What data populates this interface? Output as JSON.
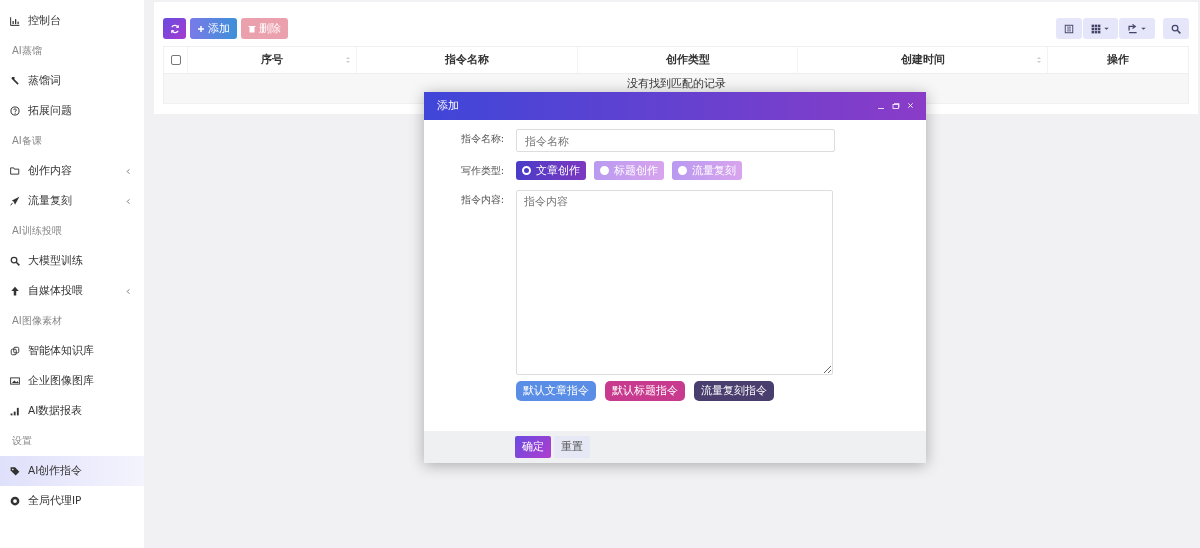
{
  "sidebar": {
    "items": [
      {
        "kind": "item",
        "label": "控制台",
        "selected": false,
        "submenu": false
      },
      {
        "kind": "header",
        "label": "AI蒸馏"
      },
      {
        "kind": "item",
        "label": "蒸馏词",
        "selected": false,
        "submenu": false
      },
      {
        "kind": "item",
        "label": "拓展问题",
        "selected": false,
        "submenu": false
      },
      {
        "kind": "header",
        "label": "AI备课"
      },
      {
        "kind": "item",
        "label": "创作内容",
        "selected": false,
        "submenu": true
      },
      {
        "kind": "item",
        "label": "流量复刻",
        "selected": false,
        "submenu": true
      },
      {
        "kind": "header",
        "label": "AI训练投喂"
      },
      {
        "kind": "item",
        "label": "大模型训练",
        "selected": false,
        "submenu": false
      },
      {
        "kind": "item",
        "label": "自媒体投喂",
        "selected": false,
        "submenu": true
      },
      {
        "kind": "header",
        "label": "AI图像素材"
      },
      {
        "kind": "item",
        "label": "智能体知识库",
        "selected": false,
        "submenu": false
      },
      {
        "kind": "item",
        "label": "企业图像图库",
        "selected": false,
        "submenu": false
      },
      {
        "kind": "item",
        "label": "AI数据报表",
        "selected": false,
        "submenu": false
      },
      {
        "kind": "header",
        "label": "设置"
      },
      {
        "kind": "item",
        "label": "AI创作指令",
        "selected": true,
        "submenu": false
      },
      {
        "kind": "item",
        "label": "全局代理IP",
        "selected": false,
        "submenu": false
      }
    ]
  },
  "toolbar": {
    "buttons": [
      {
        "kind": "refresh"
      },
      {
        "kind": "add",
        "label": "添加"
      },
      {
        "kind": "delete",
        "label": "删除",
        "disabled": true
      }
    ]
  },
  "table": {
    "columns": [
      {
        "label": "序号",
        "sortable": true
      },
      {
        "label": "指令名称",
        "sortable": false
      },
      {
        "label": "创作类型",
        "sortable": false
      },
      {
        "label": "创建时间",
        "sortable": true
      },
      {
        "label": "操作",
        "sortable": false
      }
    ],
    "select_all": {
      "checked": false
    },
    "empty_text": "没有找到匹配的记录"
  },
  "dialog": {
    "title": "添加",
    "fields": [
      {
        "kind": "input",
        "label": "指令名称:",
        "placeholder": "指令名称"
      },
      {
        "kind": "radio",
        "label": "写作类型:",
        "options": [
          {
            "label": "文章创作",
            "selected": true
          },
          {
            "label": "标题创作",
            "selected": false
          },
          {
            "label": "流量复刻",
            "selected": false
          }
        ]
      },
      {
        "kind": "textarea",
        "label": "指令内容:",
        "placeholder": "指令内容"
      }
    ],
    "presets": [
      {
        "label": "默认文章指令",
        "color": "#5a8ee6"
      },
      {
        "label": "默认标题指令",
        "color": "#c83a8e"
      },
      {
        "label": "流量复刻指令",
        "color": "#4a3e6e"
      }
    ],
    "footer_buttons": [
      {
        "kind": "primary",
        "label": "确定"
      },
      {
        "kind": "default",
        "label": "重置"
      }
    ]
  }
}
